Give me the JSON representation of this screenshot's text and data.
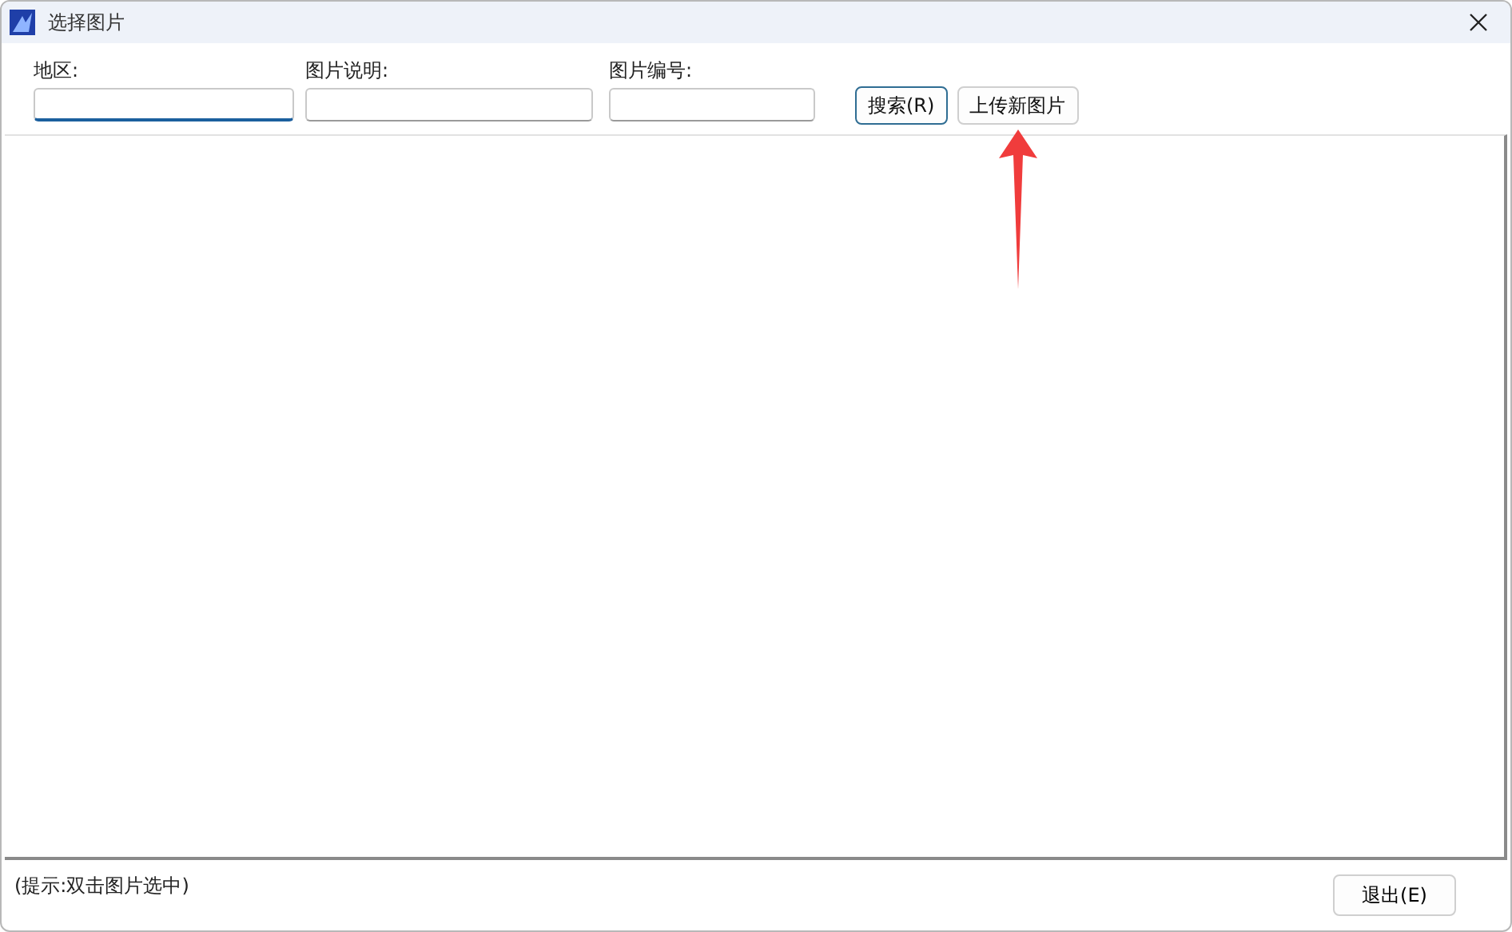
{
  "window": {
    "title": "选择图片"
  },
  "filters": [
    {
      "label": "地区:",
      "focused": true
    },
    {
      "label": "图片说明:",
      "focused": false
    },
    {
      "label": "图片编号:",
      "focused": false
    }
  ],
  "buttons": [
    {
      "label": "搜索(R)",
      "default": true
    },
    {
      "label": "上传新图片",
      "default": false
    }
  ],
  "status_hint": "(提示:双击图片选中)",
  "exit_button": "退出(E)"
}
